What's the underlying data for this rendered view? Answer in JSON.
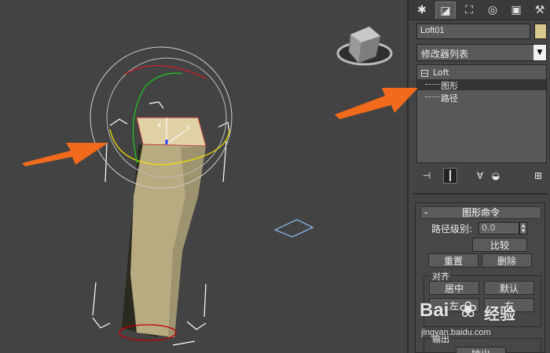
{
  "command_tabs": [
    {
      "name": "create-tab",
      "glyph": "✱"
    },
    {
      "name": "modify-tab",
      "glyph": "◪"
    },
    {
      "name": "hierarchy-tab",
      "glyph": "⛶"
    },
    {
      "name": "motion-tab",
      "glyph": "◎"
    },
    {
      "name": "display-tab",
      "glyph": "▣"
    },
    {
      "name": "utilities-tab",
      "glyph": "⚒"
    }
  ],
  "object": {
    "name": "Loft01",
    "color": "#d9c98f"
  },
  "modifier_list": {
    "label": "修改器列表"
  },
  "stack": {
    "root": "Loft",
    "items": [
      {
        "label": "图形",
        "selected": true
      },
      {
        "label": "路径",
        "selected": false
      }
    ]
  },
  "shape_commands": {
    "title": "图形命令",
    "path_level_label": "路径级别:",
    "path_level_value": "0.0",
    "compare": "比较",
    "reset": "重置",
    "delete": "删除",
    "align_group": "对齐",
    "center": "居中",
    "default": "默认",
    "left": "左",
    "right": "右",
    "output_group": "输出",
    "output_button": "输出"
  },
  "viewport": {
    "gizmo_axis_x": "x",
    "gizmo_axis_y": "y",
    "arrow_color": "#f26a1b",
    "object_color": "#b8ab82"
  },
  "watermark": {
    "brand": "Bai",
    "brand2": "经验",
    "url": "jingyan.baidu.com"
  }
}
